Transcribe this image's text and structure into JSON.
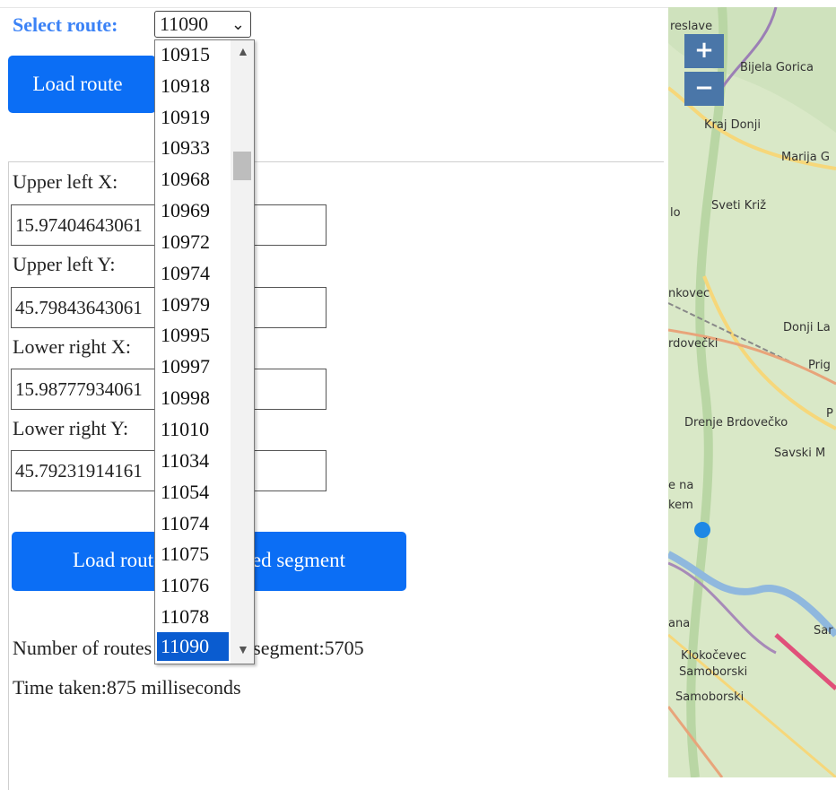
{
  "route_selector": {
    "label": "Select route:",
    "selected_value": "11090",
    "chevron": "chevron-down-icon",
    "options": [
      "10915",
      "10918",
      "10919",
      "10933",
      "10968",
      "10969",
      "10972",
      "10974",
      "10979",
      "10995",
      "10997",
      "10998",
      "11010",
      "11034",
      "11054",
      "11074",
      "11075",
      "11076",
      "11078",
      "11090"
    ]
  },
  "buttons": {
    "load_route": "Load route",
    "load_routes_segment": "Load routes for selected segment"
  },
  "bbox_form": {
    "upper_left_x_label": "Upper left X:",
    "upper_left_x_value": "15.97404643061",
    "upper_left_y_label": "Upper left Y:",
    "upper_left_y_value": "45.79843643061",
    "lower_right_x_label": "Lower right X:",
    "lower_right_x_value": "15.98777934061",
    "lower_right_y_label": "Lower right Y:",
    "lower_right_y_value": "45.79231914161"
  },
  "results": {
    "count_text": "Number of routes for selected segment:5705",
    "time_text": "Time taken:875 milliseconds"
  },
  "map": {
    "zoom_in": "+",
    "zoom_out": "−",
    "place_labels": [
      "Bijela Gorica",
      "Kraj Donji",
      "Marija G",
      "Sveti Križ",
      "Donji La",
      "Prig",
      "Drenje Brdovečko",
      "Savski M",
      "Klokočevec",
      "Samoborski",
      "Samoborski"
    ],
    "partial_labels": [
      "reslave",
      "lo",
      "nkovec",
      "rdovečki",
      "e na",
      "kem",
      "ana",
      "Sar",
      "P"
    ],
    "colors": {
      "land": "#d8e7c8",
      "road": "#f6d77a",
      "river": "#8fb8de",
      "marker": "#1e88e5"
    }
  }
}
